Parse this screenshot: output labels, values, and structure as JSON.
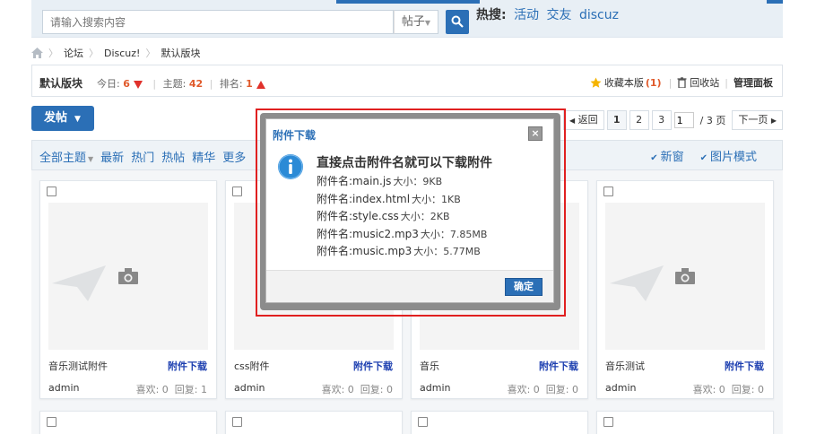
{
  "search": {
    "placeholder": "请输入搜索内容",
    "type": "帖子"
  },
  "hot": {
    "label": "热搜:",
    "links": [
      "活动",
      "交友",
      "discuz"
    ]
  },
  "breadcrumb": [
    "论坛",
    "Discuz!",
    "默认版块"
  ],
  "forum": {
    "name": "默认版块",
    "today_label": "今日:",
    "today": "6",
    "topics_label": "主题:",
    "topics": "42",
    "rank_label": "排名:",
    "rank": "1",
    "favorite_label": "收藏本版",
    "favorite_count": "(1)",
    "recycle_label": "回收站",
    "admin_label": "管理面板"
  },
  "post_button": "发帖",
  "pager": {
    "back": "返回",
    "pages": [
      "1",
      "2",
      "3"
    ],
    "input": "1",
    "total": "/ 3 页",
    "next": "下一页"
  },
  "filters": {
    "tabs": [
      "全部主题",
      "最新",
      "热门",
      "热帖",
      "精华",
      "更多"
    ],
    "new_window": "新窗",
    "image_mode": "图片模式"
  },
  "cards": [
    {
      "title": "音乐测试附件",
      "download": "附件下载",
      "author": "admin",
      "likes": "喜欢: 0",
      "replies": "回复: 1"
    },
    {
      "title": "css附件",
      "download": "附件下载",
      "author": "admin",
      "likes": "喜欢: 0",
      "replies": "回复: 0"
    },
    {
      "title": "音乐",
      "download": "附件下载",
      "author": "admin",
      "likes": "喜欢: 0",
      "replies": "回复: 0"
    },
    {
      "title": "音乐测试",
      "download": "附件下载",
      "author": "admin",
      "likes": "喜欢: 0",
      "replies": "回复: 0"
    }
  ],
  "modal": {
    "title": "附件下载",
    "close": "×",
    "heading": "直接点击附件名就可以下载附件",
    "files": [
      {
        "name": "附件名:main.js",
        "size": "大小：9KB"
      },
      {
        "name": "附件名:index.html",
        "size": "大小：1KB"
      },
      {
        "name": "附件名:style.css",
        "size": "大小：2KB"
      },
      {
        "name": "附件名:music2.mp3",
        "size": "大小：7.85MB"
      },
      {
        "name": "附件名:music.mp3",
        "size": "大小：5.77MB"
      }
    ],
    "ok": "确定"
  },
  "colors": {
    "accent": "#2b6fb6",
    "highlight": "#e02020",
    "download_link": "#1d3fb0"
  }
}
